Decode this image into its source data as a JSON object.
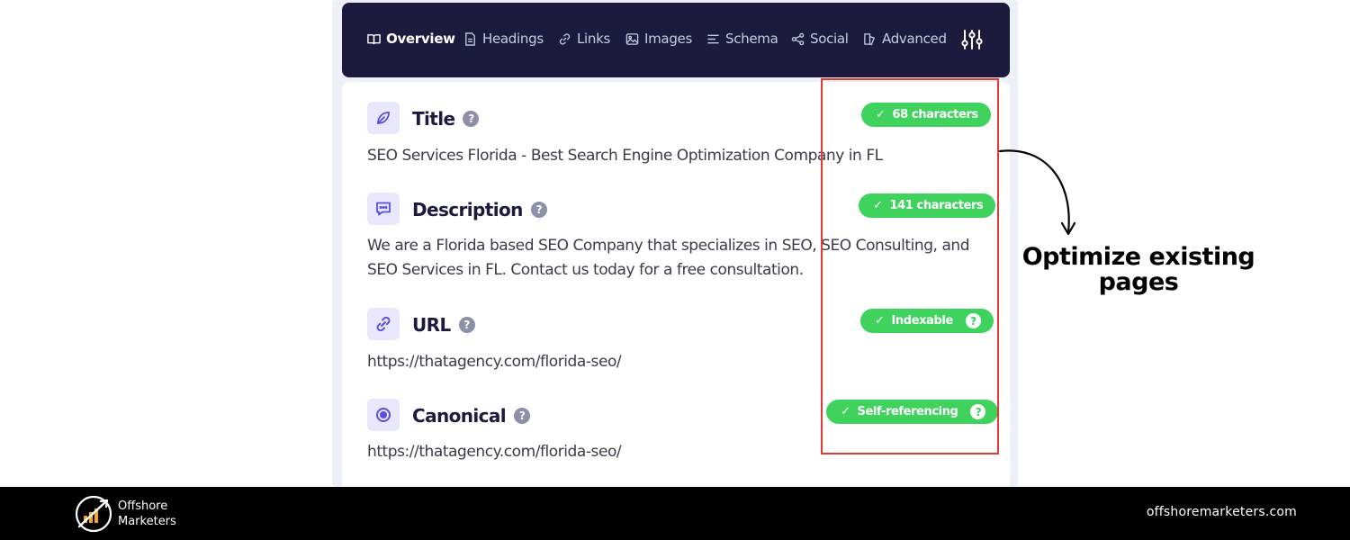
{
  "nav": {
    "tabs": [
      {
        "label": "Overview",
        "icon": "book-icon",
        "active": true
      },
      {
        "label": "Headings",
        "icon": "document-icon",
        "active": false
      },
      {
        "label": "Links",
        "icon": "link-icon",
        "active": false
      },
      {
        "label": "Images",
        "icon": "image-icon",
        "active": false
      },
      {
        "label": "Schema",
        "icon": "list-icon",
        "active": false
      },
      {
        "label": "Social",
        "icon": "share-icon",
        "active": false
      },
      {
        "label": "Advanced",
        "icon": "advanced-icon",
        "active": false
      }
    ],
    "settings_icon": "sliders-icon"
  },
  "rows": [
    {
      "title": "Title",
      "icon": "leaf-icon",
      "badge": "68 characters",
      "badge_help": false,
      "text": "SEO Services Florida - Best Search Engine Optimization Company in FL"
    },
    {
      "title": "Description",
      "icon": "message-icon",
      "badge": "141 characters",
      "badge_help": false,
      "text_lines": [
        "We are a Florida based SEO Company that specializes in SEO, SEO Consulting, and",
        "SEO Services in FL. Contact us today for a free consultation."
      ]
    },
    {
      "title": "URL",
      "icon": "link-icon",
      "badge": "Indexable",
      "badge_help": true,
      "text": "https://thatagency.com/florida-seo/"
    },
    {
      "title": "Canonical",
      "icon": "target-icon",
      "badge": "Self-referencing",
      "badge_help": true,
      "text": "https://thatagency.com/florida-seo/"
    }
  ],
  "help_glyph": "?",
  "check_glyph": "✓",
  "annotation": {
    "line1": "Optimize existing",
    "line2": "pages"
  },
  "footer": {
    "logo_line1": "Offshore",
    "logo_line2": "Marketers",
    "url": "offshoremarketers.com"
  },
  "colors": {
    "nav_bg": "#1c1b3d",
    "badge_green": "#3fd35e",
    "accent_purple": "#5b4fe0",
    "highlight_red": "#e53935",
    "logo_orange": "#f5a623"
  }
}
